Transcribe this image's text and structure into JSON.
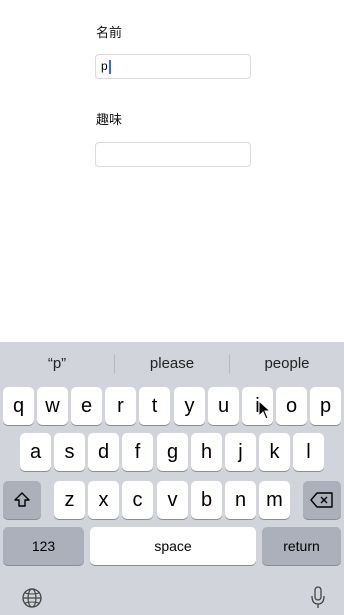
{
  "form": {
    "name_label": "名前",
    "name_value": "p",
    "hobby_label": "趣味",
    "hobby_value": ""
  },
  "keyboard": {
    "suggestions": [
      "“p”",
      "please",
      "people"
    ],
    "row1": [
      "q",
      "w",
      "e",
      "r",
      "t",
      "y",
      "u",
      "i",
      "o",
      "p"
    ],
    "row2": [
      "a",
      "s",
      "d",
      "f",
      "g",
      "h",
      "j",
      "k",
      "l"
    ],
    "row3": [
      "z",
      "x",
      "c",
      "v",
      "b",
      "n",
      "m"
    ],
    "numbers_label": "123",
    "space_label": "space",
    "return_label": "return"
  },
  "colors": {
    "keyboard_bg": "#d1d4da",
    "key_bg": "#ffffff",
    "function_key_bg": "#abb0ba",
    "caret": "#2f6df6"
  }
}
